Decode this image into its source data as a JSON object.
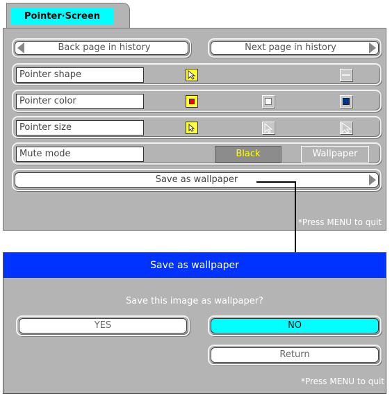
{
  "tab": {
    "label": "Pointer·Screen"
  },
  "nav": {
    "back_label": "Back page in history",
    "next_label": "Next page in history"
  },
  "rows": {
    "pointer_shape": "Pointer shape",
    "pointer_color": "Pointer color",
    "pointer_size": "Pointer size",
    "mute_mode": "Mute mode"
  },
  "mute": {
    "black_label": "Black",
    "wallpaper_label": "Wallpaper"
  },
  "save_as_wallpaper_label": "Save as wallpaper",
  "hint_top": "*Press MENU to quit",
  "dialog": {
    "title": "Save as wallpaper",
    "question": "Save this image as wallpaper?",
    "yes_label": "YES",
    "no_label": "NO",
    "return_label": "Return",
    "hint": "*Press MENU to quit"
  },
  "colors": {
    "panel_gray": "#b4b4b4",
    "tab_cyan": "#00ffff",
    "dialog_blue": "#0033ff",
    "black_button": "#8c8c8c",
    "black_button_text": "#ffff00",
    "red_swatch": "#ff0000",
    "blue_swatch": "#003399"
  }
}
